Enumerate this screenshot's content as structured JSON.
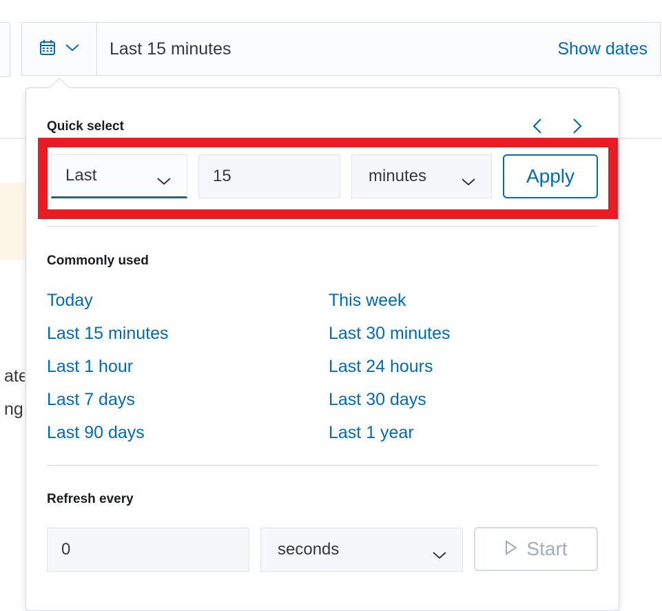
{
  "date_picker": {
    "range_text": "Last 15 minutes",
    "show_dates_label": "Show dates"
  },
  "quick_select": {
    "title": "Quick select",
    "tense": "Last",
    "value": "15",
    "unit": "minutes",
    "apply_label": "Apply"
  },
  "commonly_used": {
    "title": "Commonly used",
    "left": [
      "Today",
      "Last 15 minutes",
      "Last 1 hour",
      "Last 7 days",
      "Last 90 days"
    ],
    "right": [
      "This week",
      "Last 30 minutes",
      "Last 24 hours",
      "Last 30 days",
      "Last 1 year"
    ]
  },
  "refresh": {
    "title": "Refresh every",
    "value": "0",
    "unit": "seconds",
    "start_label": "Start"
  },
  "background": {
    "line1": "ate",
    "line2": "ng"
  },
  "colors": {
    "link": "#006bb4",
    "highlight_border": "#e81c24",
    "border": "#d3dae6"
  }
}
